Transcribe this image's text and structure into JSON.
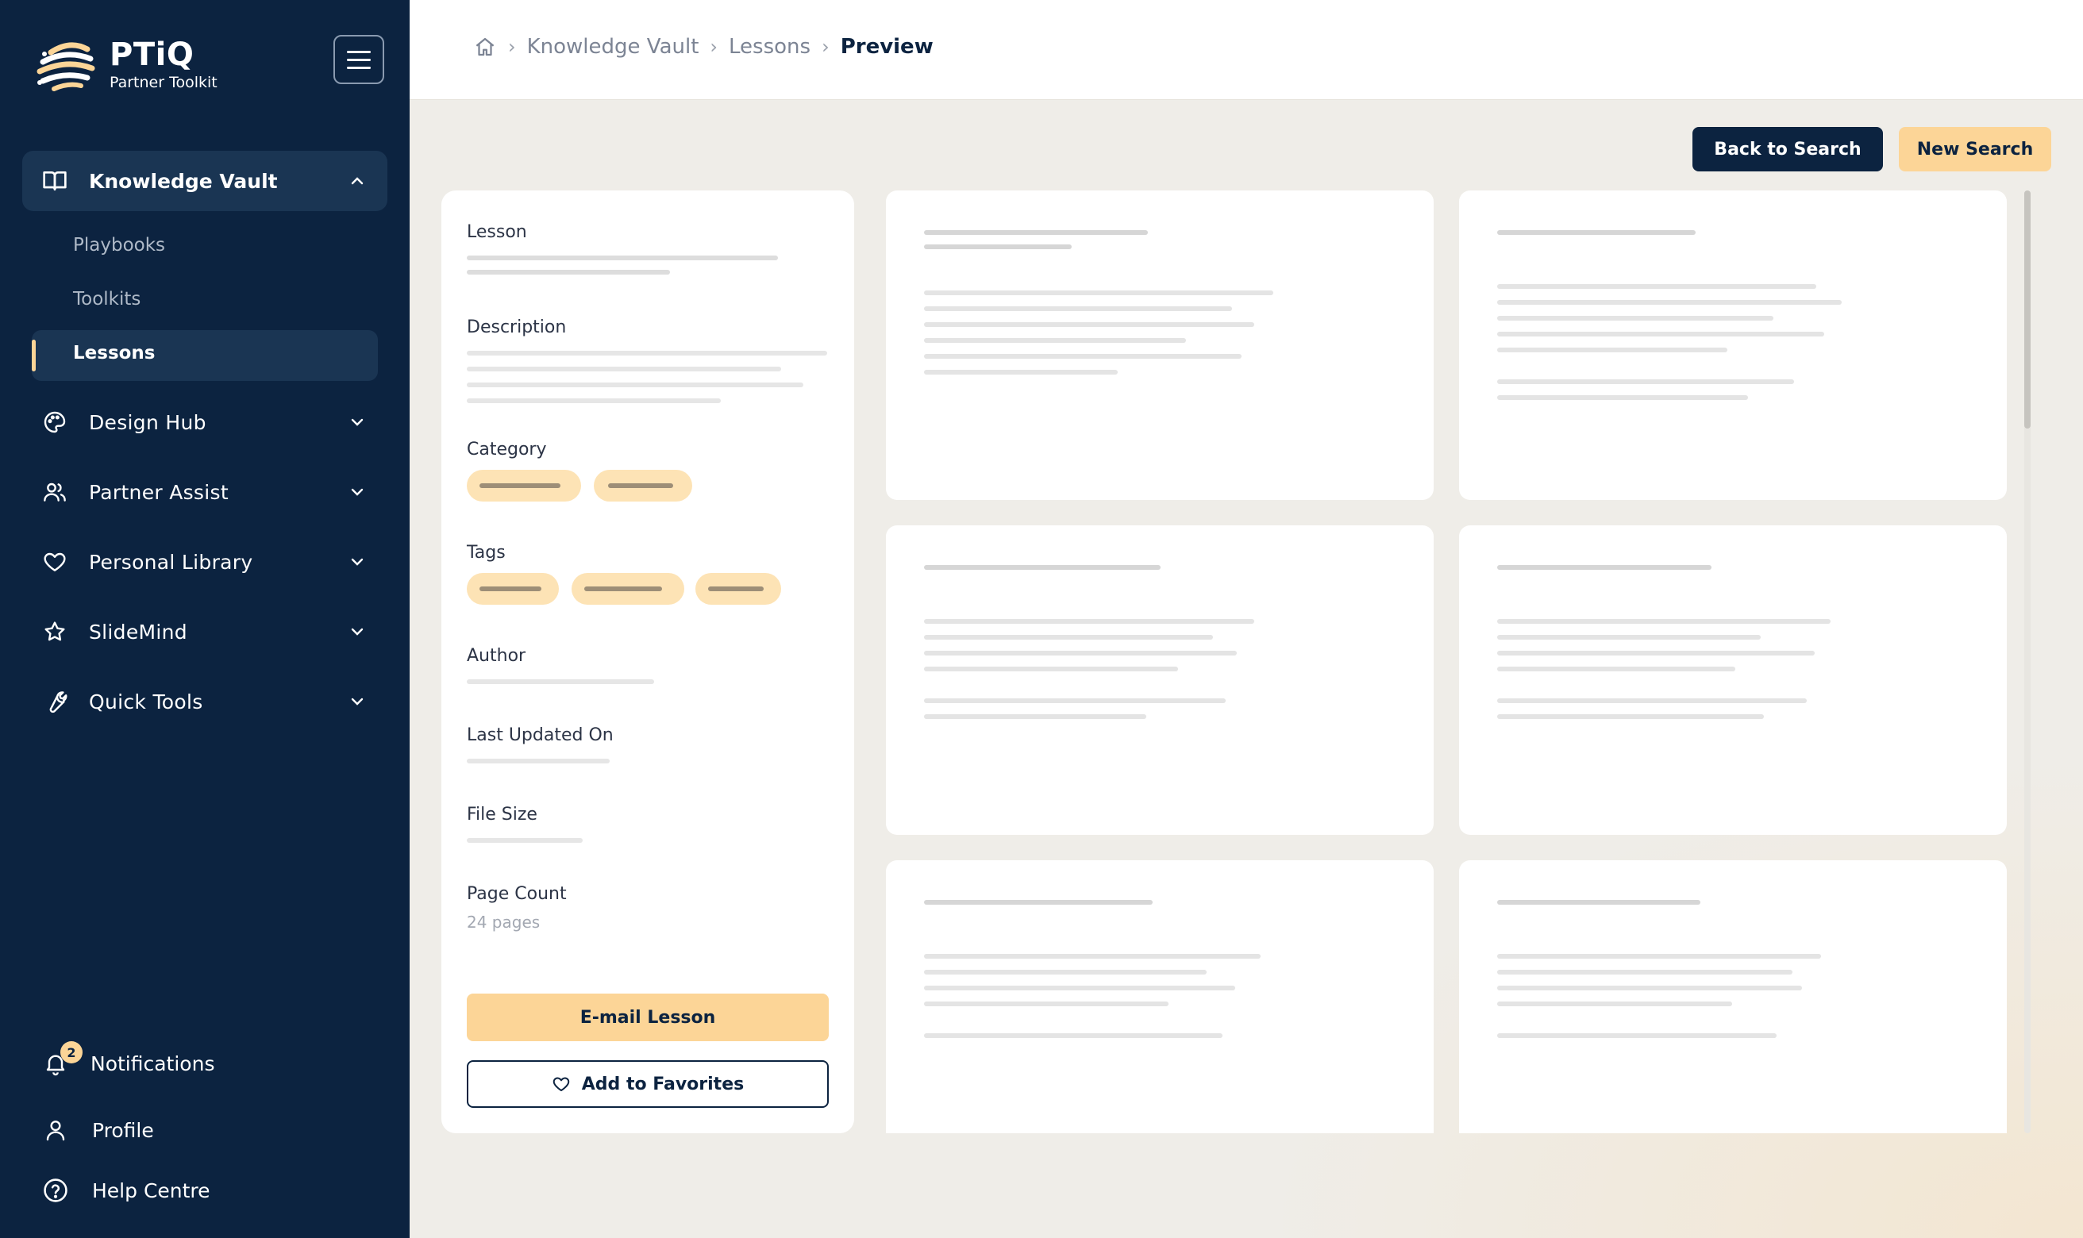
{
  "brand": {
    "title": "PTiQ",
    "subtitle": "Partner Toolkit",
    "accent_color": "#fcd597",
    "navy_color": "#0c2340"
  },
  "sidebar": {
    "section": {
      "label": "Knowledge Vault",
      "icon": "book-open-icon",
      "expanded": true
    },
    "sub_items": [
      {
        "label": "Playbooks",
        "active": false
      },
      {
        "label": "Toolkits",
        "active": false
      },
      {
        "label": "Lessons",
        "active": true
      }
    ],
    "items": [
      {
        "label": "Design Hub",
        "icon": "palette-icon"
      },
      {
        "label": "Partner Assist",
        "icon": "users-icon"
      },
      {
        "label": "Personal Library",
        "icon": "heart-icon"
      },
      {
        "label": "SlideMind",
        "icon": "star-icon"
      },
      {
        "label": "Quick Tools",
        "icon": "wrench-icon"
      }
    ],
    "bottom": {
      "notifications": {
        "label": "Notifications",
        "count": "2"
      },
      "profile": {
        "label": "Profile"
      },
      "help": {
        "label": "Help Centre"
      }
    }
  },
  "breadcrumb": {
    "items": [
      "Knowledge Vault",
      "Lessons"
    ],
    "current": "Preview",
    "separator": "›"
  },
  "actions": {
    "back_label": "Back to Search",
    "new_label": "New Search"
  },
  "details": {
    "lesson_label": "Lesson",
    "description_label": "Description",
    "category_label": "Category",
    "tags_label": "Tags",
    "author_label": "Author",
    "updated_label": "Last Updated On",
    "size_label": "File Size",
    "pages_label": "Page Count",
    "pages_value": "24 pages",
    "email_label": "E-mail Lesson",
    "favorite_label": "Add to Favorites"
  }
}
